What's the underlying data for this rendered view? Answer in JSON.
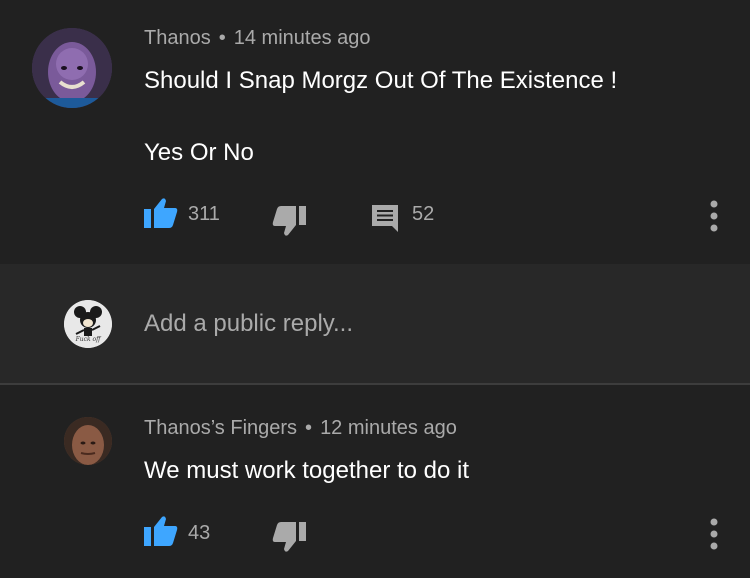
{
  "comment": {
    "author": "Thanos",
    "separator": "•",
    "time": "14 minutes ago",
    "line1": "Should I Snap Morgz Out Of The Existence !",
    "line2": "Yes Or No",
    "likes": "311",
    "replies": "52"
  },
  "reply_box": {
    "placeholder": "Add a public reply...",
    "avatar_caption": "Fuck off"
  },
  "reply": {
    "author": "Thanos’s Fingers",
    "separator": "•",
    "time": "12 minutes ago",
    "text": "We must work together to do it",
    "likes": "43"
  },
  "colors": {
    "like_active": "#3ea6ff",
    "icon_gray": "#aaaaaa",
    "background": "#212121",
    "reply_box_bg": "#282828"
  }
}
